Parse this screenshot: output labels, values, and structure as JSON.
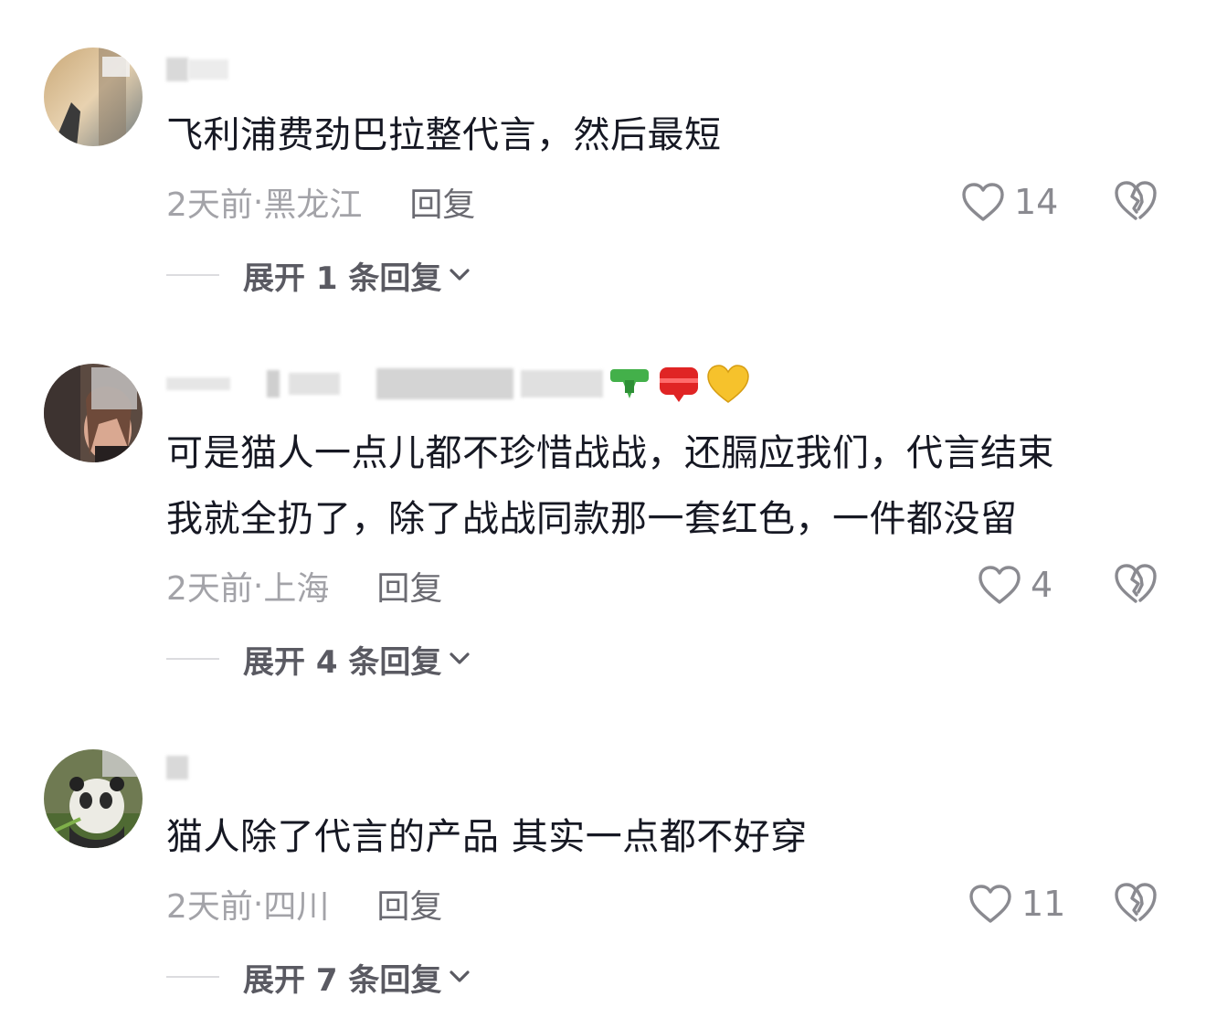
{
  "comments": [
    {
      "content": "飞利浦费劲巴拉整代言，然后最短",
      "time": "2天前",
      "location": "黑龙江",
      "reply_label": "回复",
      "likes": "14",
      "expand_label": "展开 1 条回复"
    },
    {
      "content": "可是猫人一点儿都不珍惜战战，还膈应我们，代言结束\n我就全扔了，除了战战同款那一套红色，一件都没留",
      "time": "2天前",
      "location": "上海",
      "reply_label": "回复",
      "likes": "4",
      "expand_label": "展开 4 条回复"
    },
    {
      "content": "猫人除了代言的产品 其实一点都不好穿",
      "time": "2天前",
      "location": "四川",
      "reply_label": "回复",
      "likes": "11",
      "expand_label": "展开 7 条回复"
    }
  ],
  "separator": " · ",
  "colors": {
    "text": "#161823",
    "meta": "#a3a3a8",
    "reply": "#6b6b72"
  },
  "icons": {
    "like": "heart-outline-icon",
    "dislike": "broken-heart-icon",
    "expand": "chevron-down-icon"
  }
}
